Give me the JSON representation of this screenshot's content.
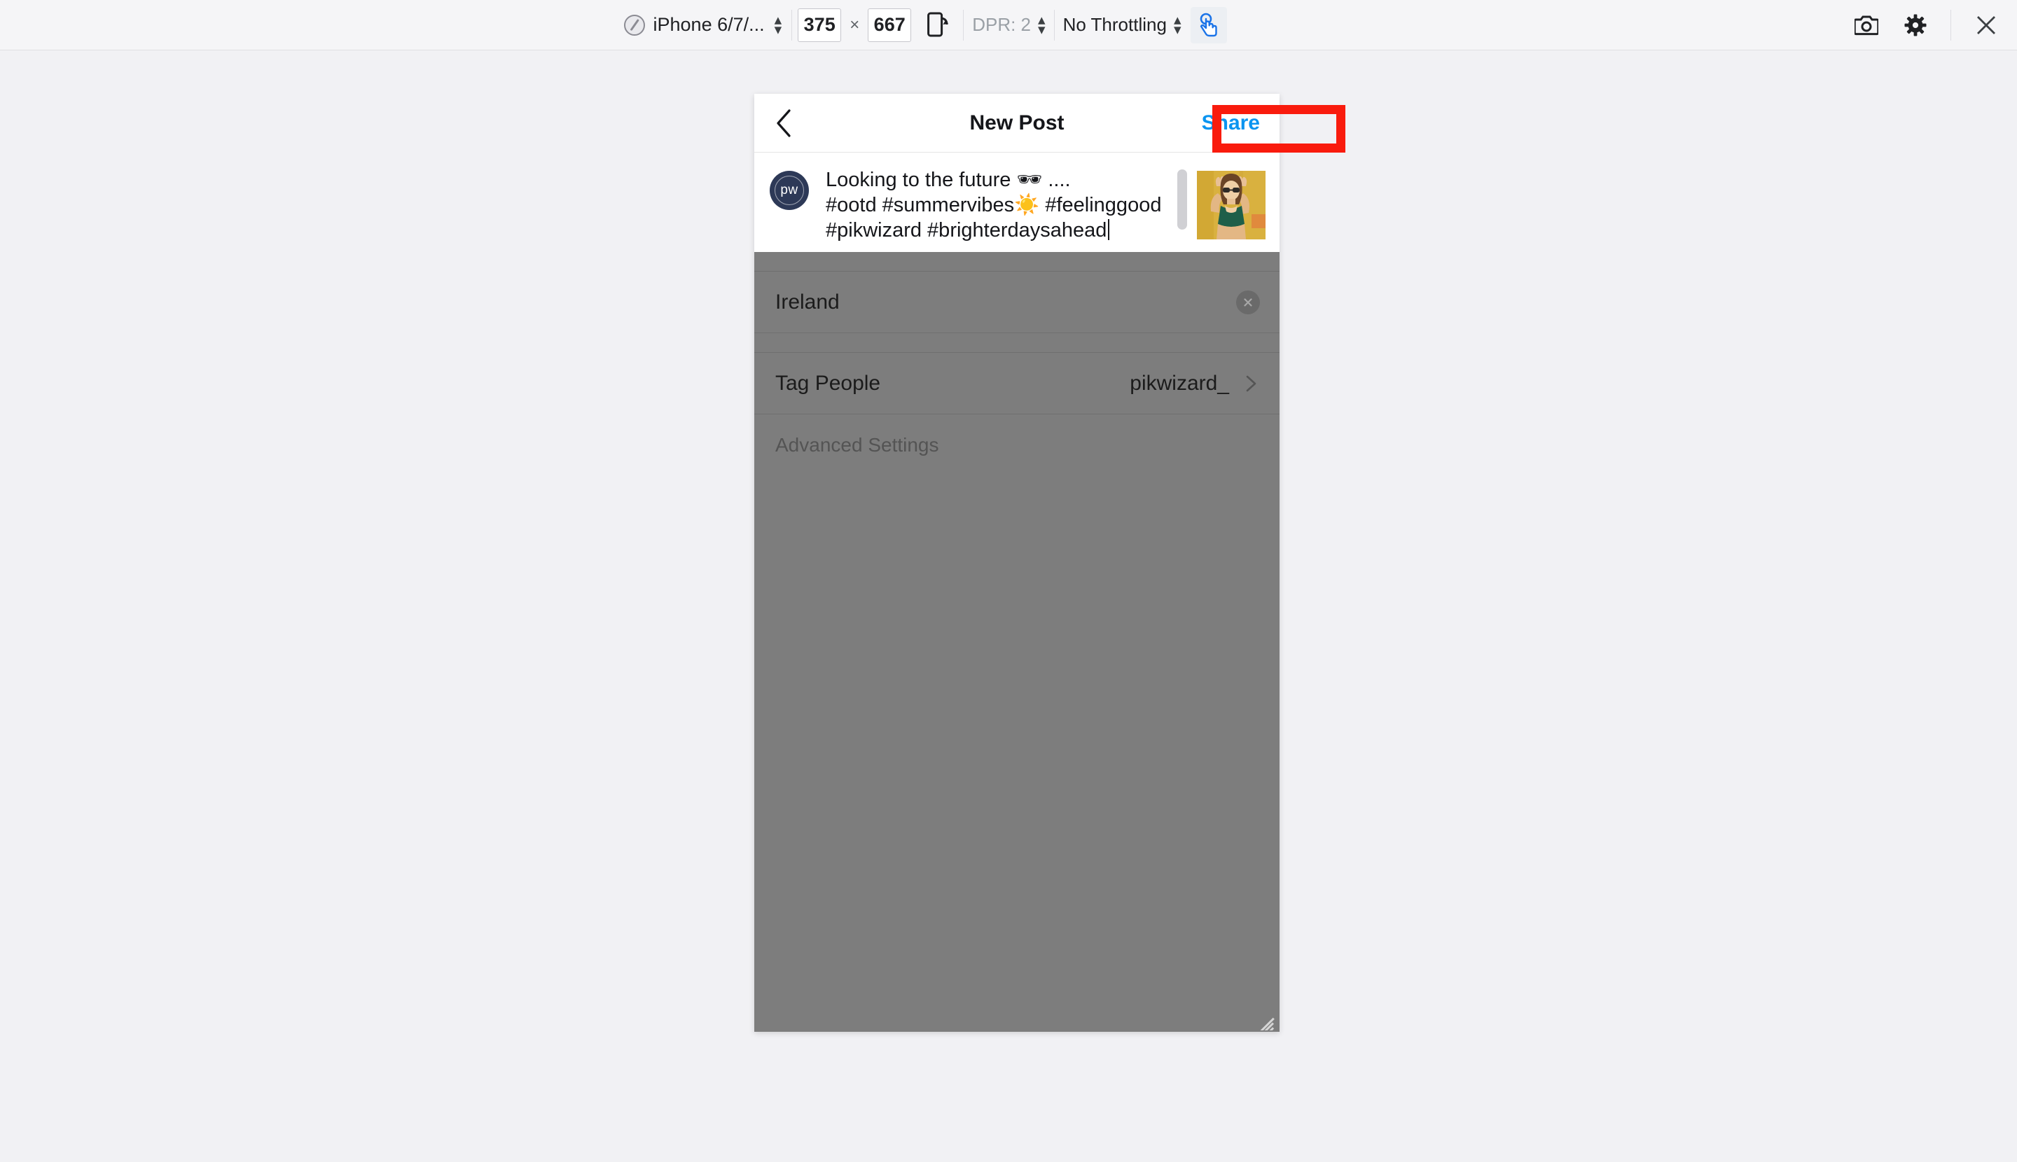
{
  "devtools_toolbar": {
    "device_icon": "device-toggle-icon",
    "device_name": "iPhone 6/7/...",
    "width_value": "375",
    "dim_separator": "×",
    "height_value": "667",
    "rotate_icon": "rotate-device-icon",
    "dpr_label": "DPR: 2",
    "throttling_label": "No Throttling",
    "touch_icon": "touch-cursor-icon",
    "screenshot_icon": "camera-icon",
    "settings_icon": "gear-icon",
    "close_icon": "close-icon"
  },
  "app": {
    "header": {
      "back_icon": "back-chevron-icon",
      "title": "New Post",
      "share_label": "Share",
      "share_color": "#0a94f0",
      "highlight_color": "#f91b0d"
    },
    "caption": {
      "avatar_initials": "pw",
      "avatar_color": "#2d3957",
      "line1": "Looking to the future 🕶 ....",
      "line2": "#ootd #summervibes☀️ #feelinggood",
      "line3": "#pikwizard #brighterdaysahead",
      "thumbnail_alt": "post-photo-thumbnail"
    },
    "location_row": {
      "label": "Ireland",
      "clear_icon": "clear-circle-x-icon"
    },
    "tag_people_row": {
      "label": "Tag People",
      "value": "pikwizard_",
      "chevron_icon": "chevron-right-icon"
    },
    "advanced_row": {
      "label": "Advanced Settings"
    },
    "overlay_color": "#7d7d7d"
  },
  "device_frame": {
    "resize_handle": "resize-handle"
  }
}
